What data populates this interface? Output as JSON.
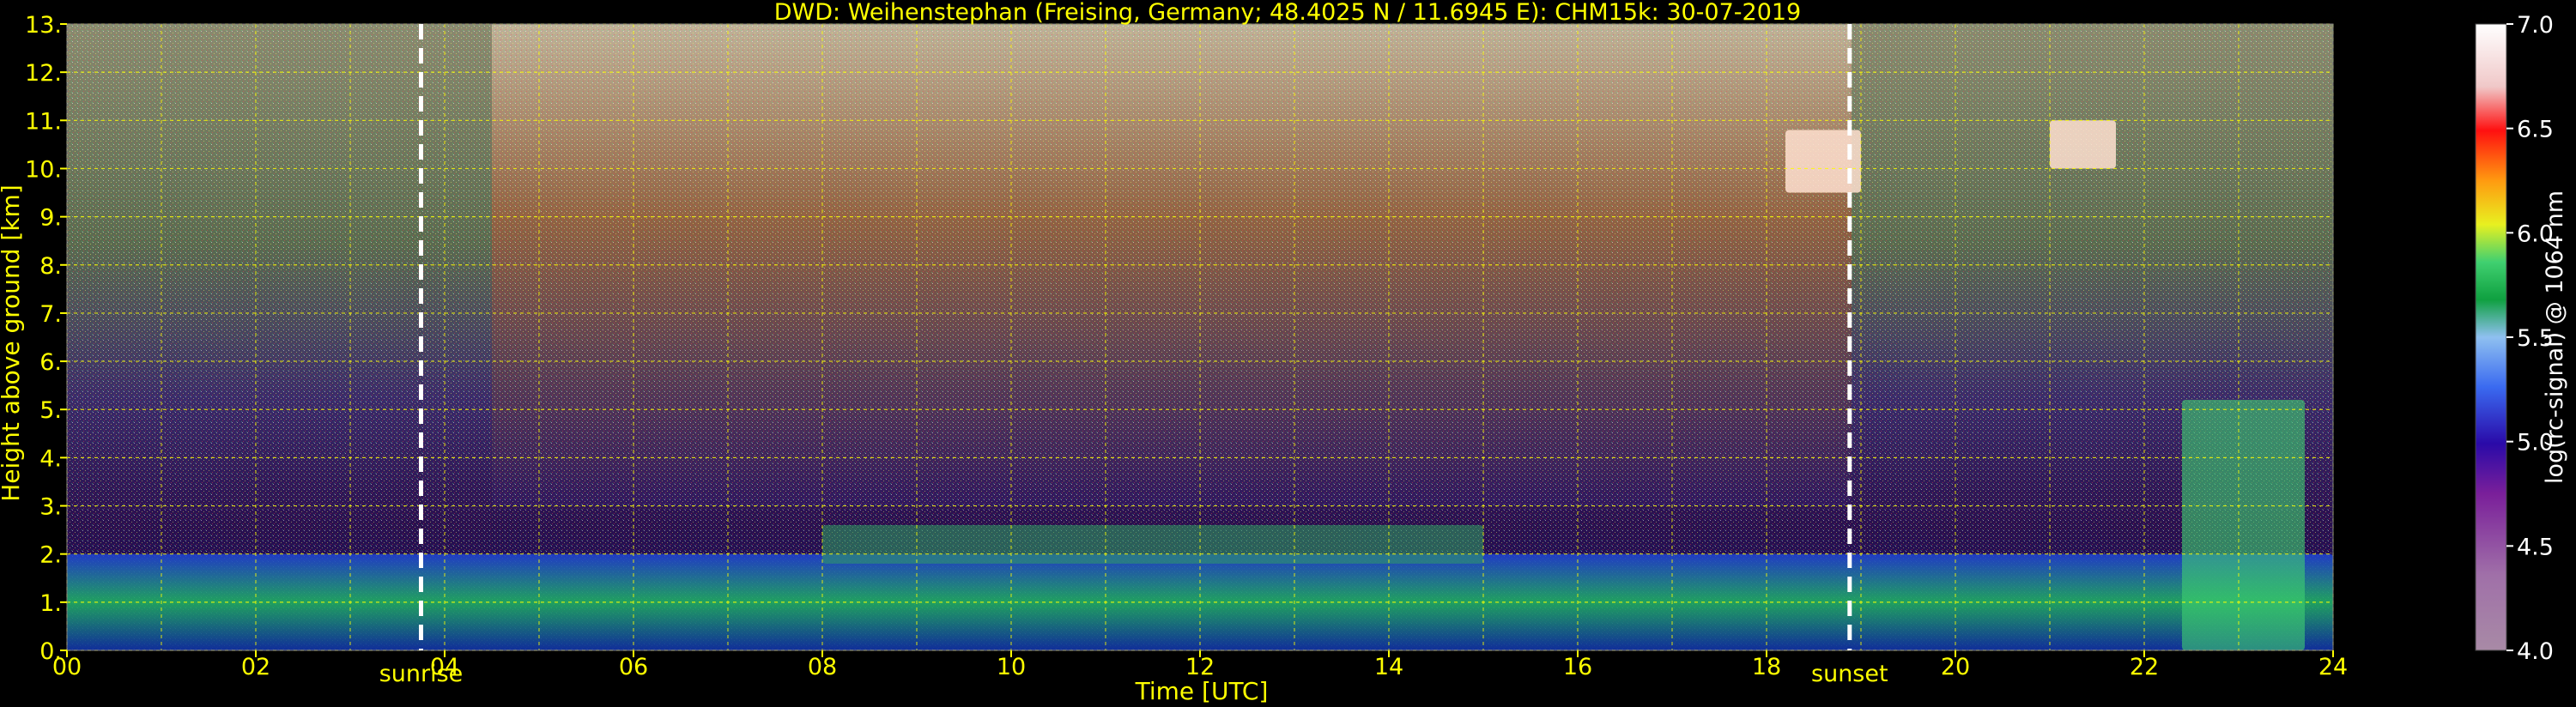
{
  "chart_data": {
    "type": "heatmap",
    "title": "DWD: Weihenstephan (Freising, Germany; 48.4025 N / 11.6945 E):    CHM15k: 30-07-2019",
    "xlabel": "Time [UTC]",
    "ylabel": "Height above ground [km]",
    "colorbar_label": "log(rc-signal) @ 1064 nm",
    "xlim": [
      0,
      24
    ],
    "ylim": [
      0,
      13
    ],
    "x_ticks": [
      "00",
      "02",
      "04",
      "06",
      "08",
      "10",
      "12",
      "14",
      "16",
      "18",
      "20",
      "22",
      "24"
    ],
    "y_ticks": [
      "0.",
      "1.",
      "2.",
      "3.",
      "4.",
      "5.",
      "6.",
      "7.",
      "8.",
      "9.",
      "10.",
      "11.",
      "12.",
      "13."
    ],
    "colorbar_ticks": [
      "4.0",
      "4.5",
      "5.0",
      "5.5",
      "6.0",
      "6.5",
      "7.0"
    ],
    "colorbar_range": [
      4.0,
      7.0
    ],
    "grid": true,
    "markers": [
      {
        "label": "sunrise",
        "x": 3.75
      },
      {
        "label": "sunset",
        "x": 18.88
      }
    ],
    "features": [
      {
        "name": "boundary layer aerosol",
        "x_range": [
          0,
          24
        ],
        "height_km": [
          0,
          2
        ]
      },
      {
        "name": "residual layer top",
        "x_range": [
          8.0,
          15.0
        ],
        "height_km": [
          1.8,
          2.6
        ]
      },
      {
        "name": "cloud",
        "x_range": [
          18.2,
          19.0
        ],
        "height_km": [
          9.5,
          10.8
        ]
      },
      {
        "name": "cloud",
        "x_range": [
          21.0,
          21.7
        ],
        "height_km": [
          10.0,
          11.0
        ]
      },
      {
        "name": "convective cloud",
        "x_range": [
          22.4,
          23.7
        ],
        "height_km": [
          0,
          5.2
        ]
      }
    ]
  },
  "colors": {
    "text": "#ffff00",
    "grid": "#ffff00",
    "background": "#000000",
    "marker": "#ffffff"
  }
}
